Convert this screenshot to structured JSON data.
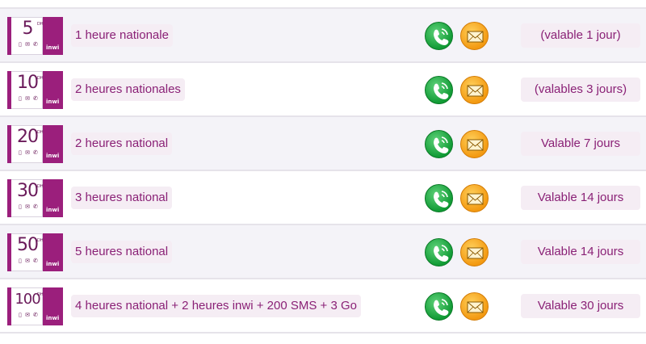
{
  "plans": [
    {
      "amount": "5",
      "currency": "DH",
      "brand": "inwi",
      "description": "1 heure nationale",
      "validity": "(valable 1 jour)"
    },
    {
      "amount": "10",
      "currency": "DH",
      "brand": "inwi",
      "description": "2 heures nationales",
      "validity": "(valables 3 jours)"
    },
    {
      "amount": "20",
      "currency": "DH",
      "brand": "inwi",
      "description": "2 heures national",
      "validity": "Valable 7 jours"
    },
    {
      "amount": "30",
      "currency": "DH",
      "brand": "inwi",
      "description": "3 heures national",
      "validity": "Valable 14 jours"
    },
    {
      "amount": "50",
      "currency": "DH",
      "brand": "inwi",
      "description": "5 heures national",
      "validity": "Valable 14 jours"
    },
    {
      "amount": "100",
      "currency": "DH",
      "brand": "inwi",
      "description": "4 heures national + 2 heures inwi + 200 SMS + 3 Go",
      "validity": "Valable 30 jours"
    }
  ],
  "icons": {
    "call": "phone-call-icon",
    "sms": "envelope-icon"
  },
  "colors": {
    "brand": "#9b1f7c",
    "text": "#8a2176",
    "call_icon": "#1aa53d",
    "sms_icon": "#f5a623",
    "row_alt": "#f4f3f8"
  }
}
